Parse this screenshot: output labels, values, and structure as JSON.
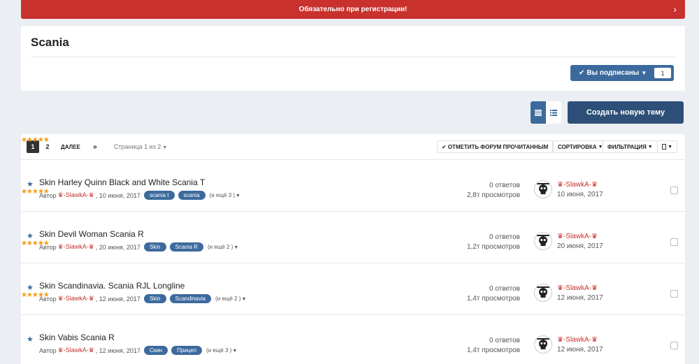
{
  "banner": {
    "text": "Обязательно при регистрации!",
    "chevron": "›"
  },
  "forum": {
    "title": "Scania",
    "follow_label": "Вы подписаны",
    "follow_count": "1",
    "create_label": "Создать новую тему"
  },
  "toolbar": {
    "pages": [
      "1",
      "2"
    ],
    "next_label": "ДАЛЕЕ",
    "last_label": "»",
    "page_info": "Страница 1 из 2",
    "mark_read_label": "ОТМЕТИТЬ ФОРУМ ПРОЧИТАННЫМ",
    "sort_label": "СОРТИРОВКА",
    "filter_label": "ФИЛЬТРАЦИЯ"
  },
  "colors": {
    "accent": "#3c6a9d",
    "banner": "#c8312c",
    "stars": "#f39c12"
  },
  "topics": [
    {
      "rating": "★★★★★",
      "title": "Skin Harley Quinn Black and White Scania T",
      "author_prefix": "Автор",
      "author": "♛-SlawkA-♛",
      "date": ", 10 июня, 2017",
      "tags": [
        "scania t",
        "scania"
      ],
      "more_tags": "(и ещё 3 )",
      "replies": "0 ответов",
      "views": "2,8т просмотров",
      "last_author": "♛-SlawkA-♛",
      "last_date": "10 июня, 2017"
    },
    {
      "rating": "★★★★★",
      "title": "Skin Devil Woman Scania R",
      "author_prefix": "Автор",
      "author": "♛-SlawkA-♛",
      "date": ", 20 июня, 2017",
      "tags": [
        "Skin",
        "Scania R"
      ],
      "more_tags": "(и ещё 2 )",
      "replies": "0 ответов",
      "views": "1,2т просмотров",
      "last_author": "♛-SlawkA-♛",
      "last_date": "20 июня, 2017"
    },
    {
      "rating": "★★★★★",
      "title": "Skin Scandinavia. Scania RJL Longline",
      "author_prefix": "Автор",
      "author": "♛-SlawkA-♛",
      "date": ", 12 июня, 2017",
      "tags": [
        "Skin",
        "Scandinavia"
      ],
      "more_tags": "(и ещё 2 )",
      "replies": "0 ответов",
      "views": "1,4т просмотров",
      "last_author": "♛-SlawkA-♛",
      "last_date": "12 июня, 2017"
    },
    {
      "rating": "★★★★★",
      "title": "Skin Vabis Scania R",
      "author_prefix": "Автор",
      "author": "♛-SlawkA-♛",
      "date": ", 12 июня, 2017",
      "tags": [
        "Скин",
        "Прицеп"
      ],
      "more_tags": "(и ещё 3 )",
      "replies": "0 ответов",
      "views": "1,4т просмотров",
      "last_author": "♛-SlawkA-♛",
      "last_date": "12 июня, 2017"
    }
  ]
}
